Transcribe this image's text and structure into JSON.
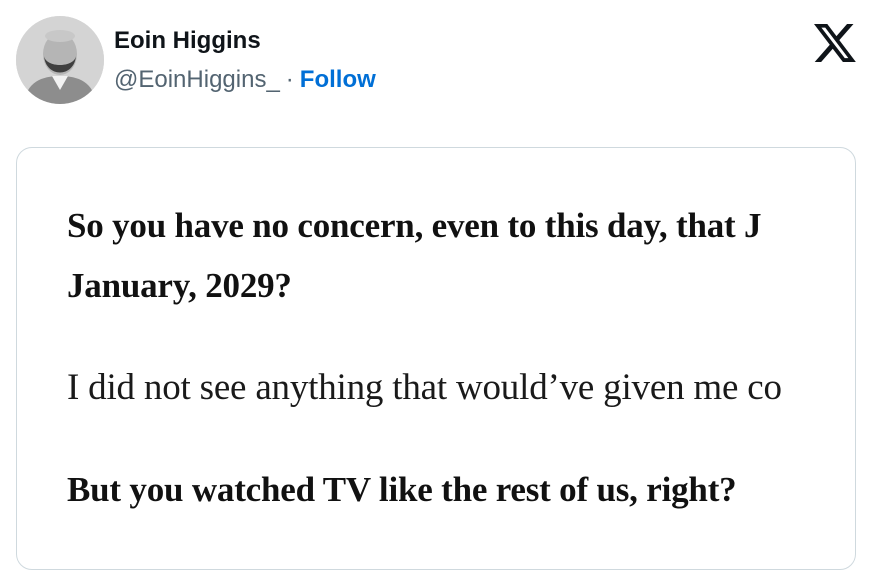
{
  "author": {
    "name": "Eoin Higgins",
    "handle": "@EoinHiggins_",
    "separator": "·",
    "follow_label": "Follow"
  },
  "platform": {
    "logo_icon": "x-logo-icon"
  },
  "quote_card": {
    "lines": [
      "So you have no concern, even to this day, that J",
      "January, 2029?",
      "I did not see anything that would’ve given me co",
      "But you watched TV like the rest of us, right?"
    ]
  },
  "colors": {
    "follow": "#006fd6",
    "text_primary": "#0f1419",
    "text_secondary": "#536471",
    "card_border": "#cfd9de"
  }
}
